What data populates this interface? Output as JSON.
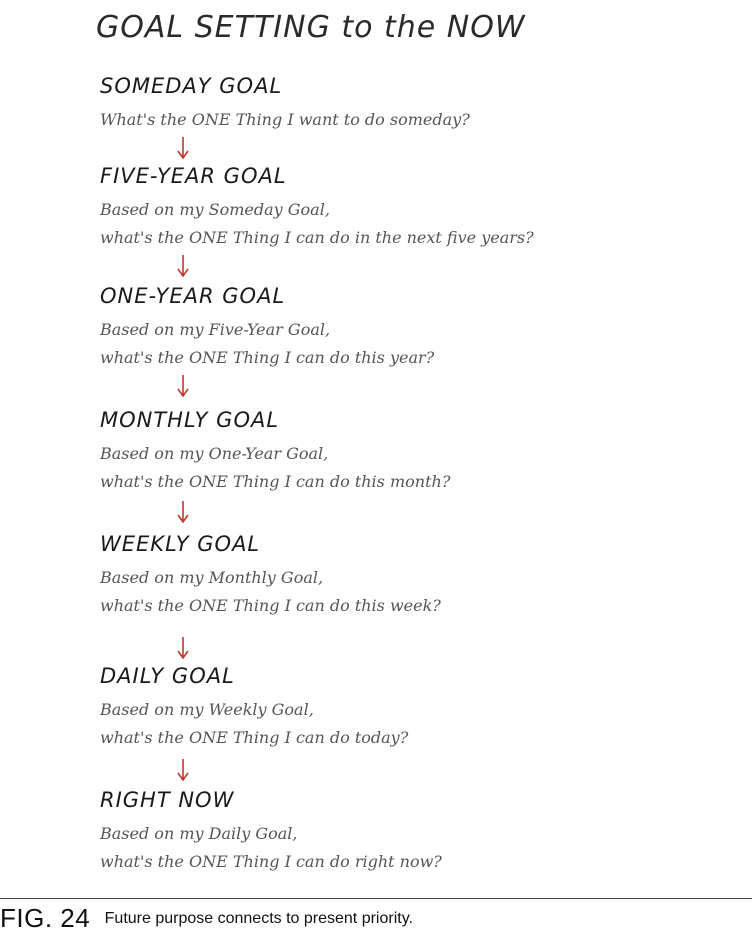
{
  "title": "GOAL SETTING to the NOW",
  "arrow_color": "#c0392b",
  "goals": [
    {
      "heading": "SOMEDAY GOAL",
      "lines": [
        "What's the ONE Thing I want to do someday?"
      ]
    },
    {
      "heading": "FIVE-YEAR GOAL",
      "lines": [
        "Based on my Someday Goal,",
        "what's the ONE Thing I can do in the next five years?"
      ]
    },
    {
      "heading": "ONE-YEAR GOAL",
      "lines": [
        "Based on my Five-Year Goal,",
        "what's the ONE Thing I can do this year?"
      ]
    },
    {
      "heading": "MONTHLY GOAL",
      "lines": [
        "Based on my One-Year Goal,",
        "what's the ONE Thing I can do this month?"
      ]
    },
    {
      "heading": "WEEKLY GOAL",
      "lines": [
        "Based on my Monthly Goal,",
        "what's the ONE Thing I can do this week?"
      ]
    },
    {
      "heading": "DAILY GOAL",
      "lines": [
        "Based on my Weekly Goal,",
        "what's the ONE Thing I can do today?"
      ]
    },
    {
      "heading": "RIGHT NOW",
      "lines": [
        "Based on my Daily Goal,",
        "what's the ONE Thing I can do right now?"
      ]
    }
  ],
  "caption": {
    "label": "FIG. 24",
    "text": "Future purpose connects to present priority."
  }
}
